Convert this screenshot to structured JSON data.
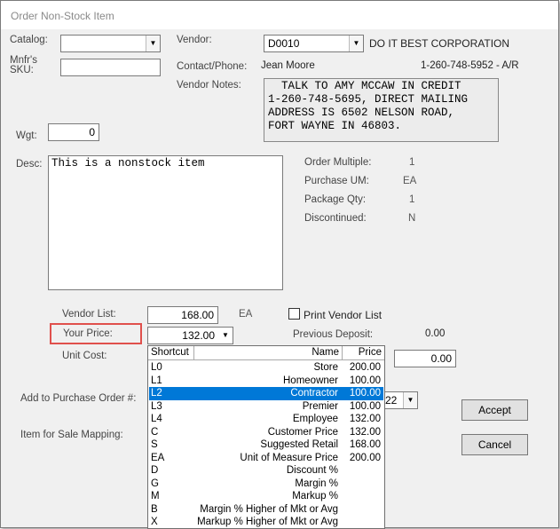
{
  "window": {
    "title": "Order Non-Stock Item"
  },
  "catalog": {
    "label": "Catalog:",
    "value": ""
  },
  "mfr_sku": {
    "label_line1": "Mnfr's",
    "label_line2": "SKU:",
    "value": ""
  },
  "wgt": {
    "label": "Wgt:",
    "value": "0"
  },
  "vendor": {
    "label": "Vendor:",
    "code": "D0010",
    "name": "DO IT BEST CORPORATION"
  },
  "contact": {
    "label": "Contact/Phone:",
    "name": "Jean Moore",
    "phone": "1-260-748-5952 - A/R"
  },
  "vendor_notes": {
    "label": "Vendor Notes:",
    "text": "  TALK TO AMY MCCAW IN CREDIT\n1-260-748-5695, DIRECT MAILING\nADDRESS IS 6502 NELSON ROAD,\nFORT WAYNE IN 46803."
  },
  "desc": {
    "label": "Desc:",
    "value": "This is a nonstock item"
  },
  "info": [
    {
      "label": "Order Multiple:",
      "value": "1"
    },
    {
      "label": "Purchase UM:",
      "value": "EA"
    },
    {
      "label": "Package Qty:",
      "value": "1"
    },
    {
      "label": "Discontinued:",
      "value": "N"
    }
  ],
  "vendor_list": {
    "label": "Vendor List:",
    "value": "168.00",
    "unit": "EA"
  },
  "print_vendor_list": {
    "label": "Print Vendor List",
    "checked": false
  },
  "your_price": {
    "label": "Your Price:",
    "value": "132.00"
  },
  "previous_deposit": {
    "label": "Previous Deposit:",
    "value": "0.00"
  },
  "unit_cost": {
    "label": "Unit Cost:",
    "value": "0.00"
  },
  "add_po": {
    "label": "Add to Purchase Order #:",
    "value_tail": "22"
  },
  "sale_mapping": {
    "label": "Item for Sale Mapping:"
  },
  "buttons": {
    "accept": "Accept",
    "cancel": "Cancel"
  },
  "price_dropdown": {
    "headers": {
      "shortcut": "Shortcut",
      "name": "Name",
      "price": "Price"
    },
    "selected_index": 2,
    "rows": [
      {
        "shortcut": "L0",
        "name": "Store",
        "price": "200.00"
      },
      {
        "shortcut": "L1",
        "name": "Homeowner",
        "price": "100.00"
      },
      {
        "shortcut": "L2",
        "name": "Contractor",
        "price": "100.00"
      },
      {
        "shortcut": "L3",
        "name": "Premier",
        "price": "100.00"
      },
      {
        "shortcut": "L4",
        "name": "Employee",
        "price": "132.00"
      },
      {
        "shortcut": "C",
        "name": "Customer Price",
        "price": "132.00"
      },
      {
        "shortcut": "S",
        "name": "Suggested Retail",
        "price": "168.00"
      },
      {
        "shortcut": "EA",
        "name": "Unit of Measure Price",
        "price": "200.00"
      },
      {
        "shortcut": "D",
        "name": "Discount %",
        "price": ""
      },
      {
        "shortcut": "G",
        "name": "Margin %",
        "price": ""
      },
      {
        "shortcut": "M",
        "name": "Markup %",
        "price": ""
      },
      {
        "shortcut": "B",
        "name": "Margin % Higher of Mkt or Avg",
        "price": ""
      },
      {
        "shortcut": "X",
        "name": "Markup % Higher of Mkt or Avg",
        "price": ""
      }
    ]
  },
  "colors": {
    "selection": "#0078d7",
    "highlight_box": "#e0504c"
  }
}
